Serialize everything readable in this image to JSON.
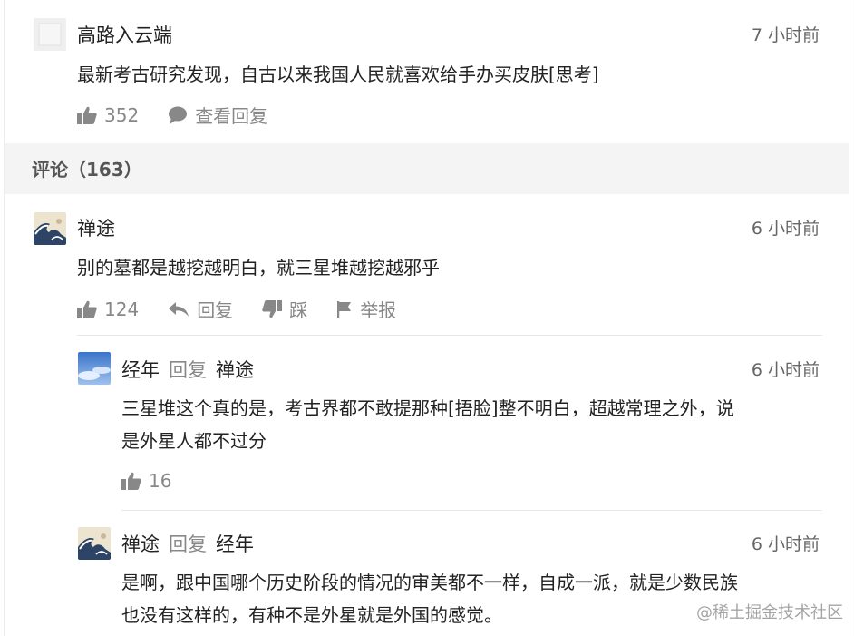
{
  "post": {
    "author": "高路入云端",
    "time": "7 小时前",
    "text": "最新考古研究发现，自古以来我国人民就喜欢给手办买皮肤[思考]",
    "likes": "352",
    "view_replies": "查看回复"
  },
  "comments_header": "评论（163）",
  "comments": [
    {
      "author": "禅途",
      "time": "6 小时前",
      "text": "别的墓都是越挖越明白，就三星堆越挖越邪乎",
      "likes": "124",
      "reply_label": "回复",
      "dislike_label": "踩",
      "report_label": "举报"
    }
  ],
  "replies": [
    {
      "author": "经年",
      "reply_word": "回复",
      "target": "禅途",
      "time": "6 小时前",
      "text_line1": "三星堆这个真的是，考古界都不敢提那种[捂脸]整不明白，超越常理之外，说",
      "text_line2": "是外星人都不过分",
      "likes": "16"
    },
    {
      "author": "禅途",
      "reply_word": "回复",
      "target": "经年",
      "time": "6 小时前",
      "text_line1": "是啊，跟中国哪个历史阶段的情况的审美都不一样，自成一派，就是少数民族",
      "text_line2": "也没有这样的，有种不是外星就是外国的感觉。"
    }
  ],
  "watermark": "@稀土掘金技术社区",
  "icons": {
    "like": "thumbs-up-icon",
    "comment": "speech-bubble-icon",
    "reply": "reply-arrow-icon",
    "dislike": "thumbs-down-icon",
    "report": "flag-icon"
  },
  "colors": {
    "section_bg": "#f4f4f4",
    "muted_text": "#888888"
  }
}
